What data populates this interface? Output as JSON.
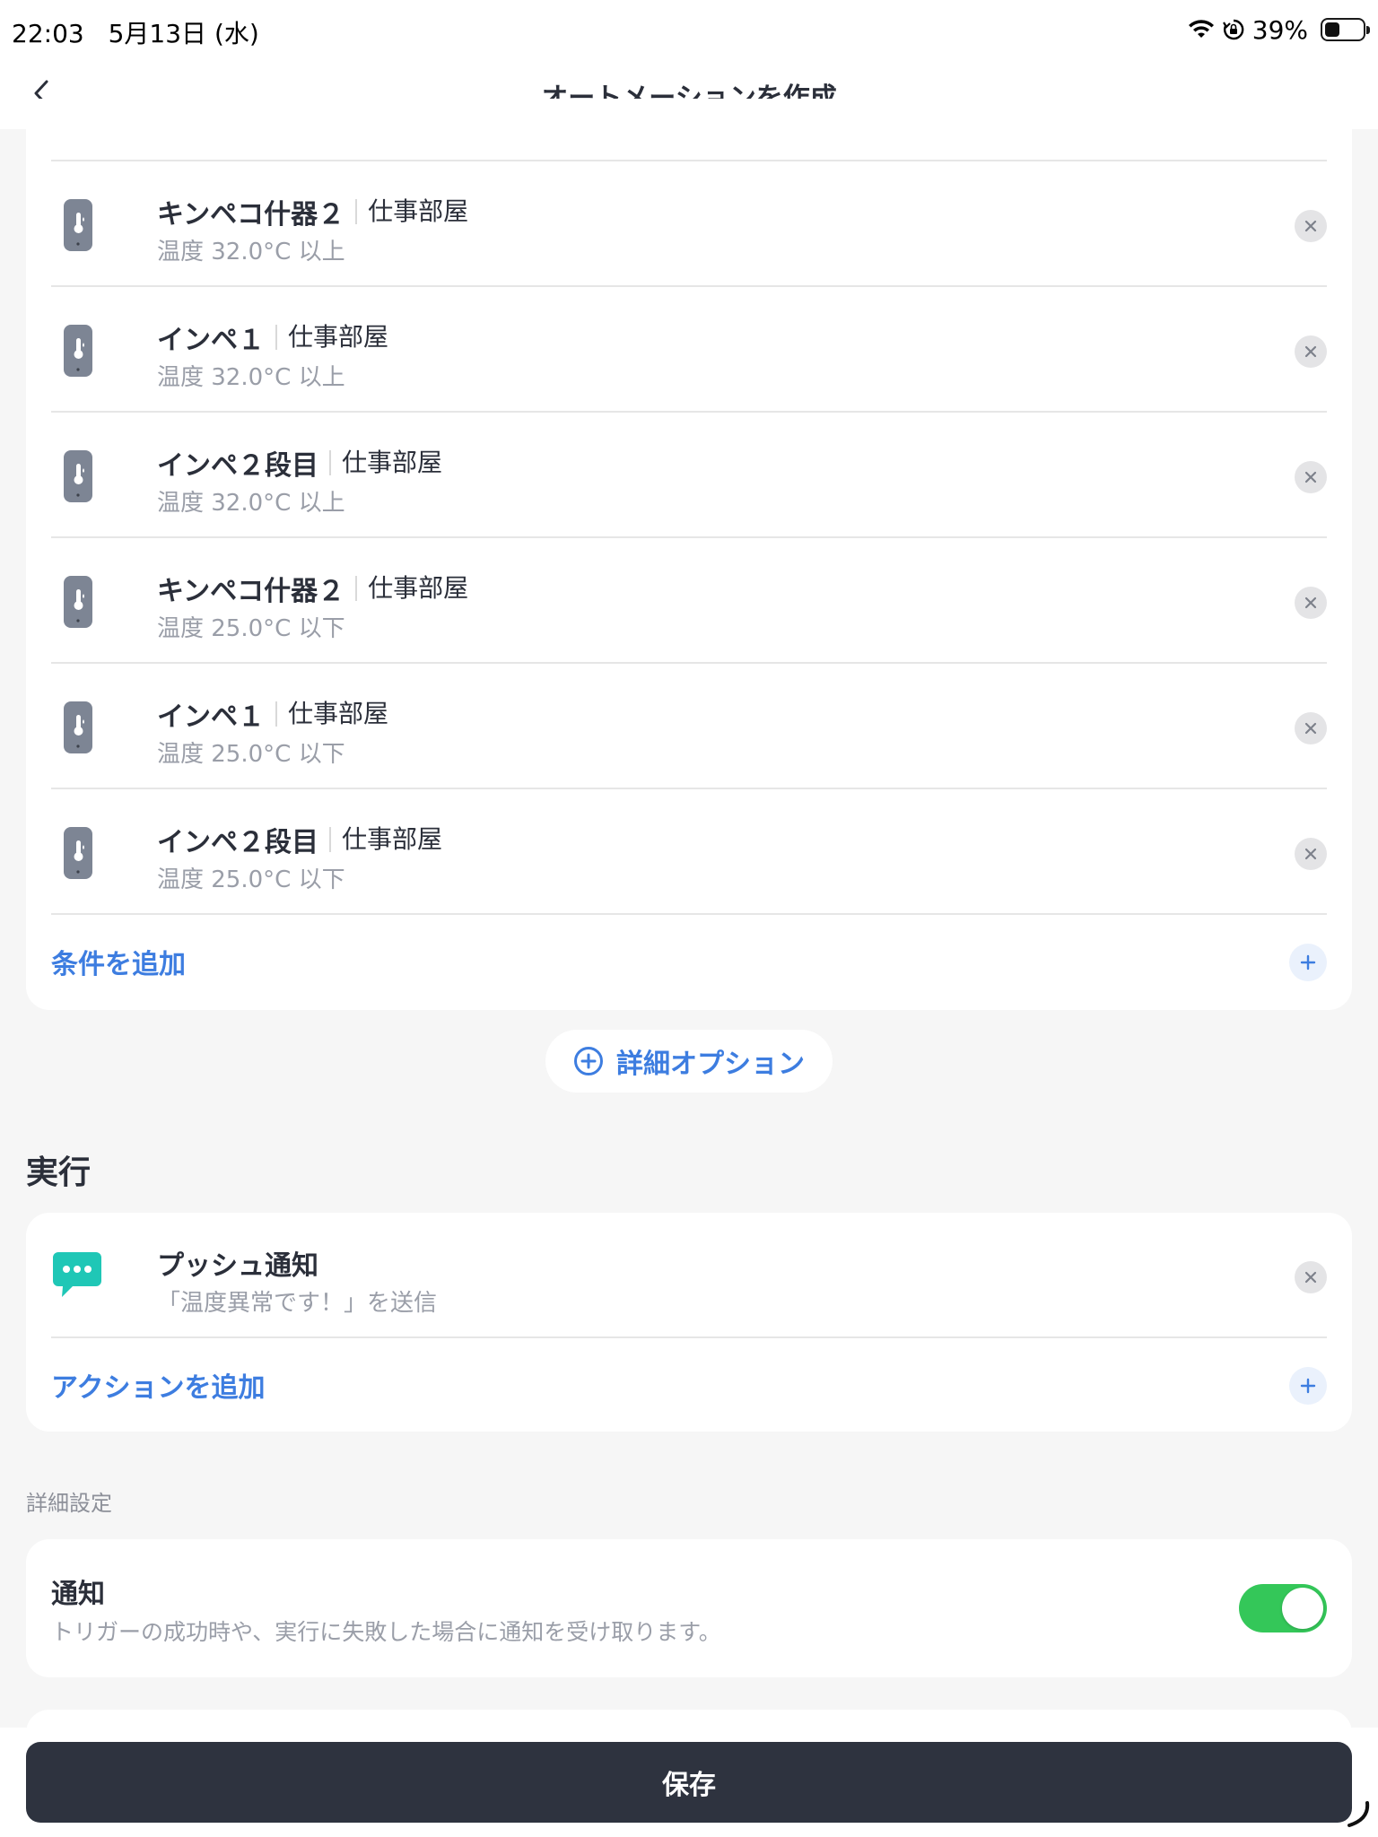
{
  "status_bar": {
    "time": "22:03",
    "date": "5月13日 (水)",
    "battery": "39%",
    "battery_level": 0.39
  },
  "nav": {
    "title": "オートメーションを作成",
    "back_icon": "chevron-left-icon"
  },
  "conditions": {
    "items": [
      {
        "name": "キンペコ什器２",
        "room": "仕事部屋",
        "condition": "温度 32.0°C 以上"
      },
      {
        "name": "インペ１",
        "room": "仕事部屋",
        "condition": "温度 32.0°C 以上"
      },
      {
        "name": "インペ２段目",
        "room": "仕事部屋",
        "condition": "温度 32.0°C 以上"
      },
      {
        "name": "キンペコ什器２",
        "room": "仕事部屋",
        "condition": "温度 25.0°C 以下"
      },
      {
        "name": "インペ１",
        "room": "仕事部屋",
        "condition": "温度 25.0°C 以下"
      },
      {
        "name": "インペ２段目",
        "room": "仕事部屋",
        "condition": "温度 25.0°C 以下"
      }
    ],
    "add_label": "条件を追加"
  },
  "detail_option": {
    "label": "詳細オプション"
  },
  "execution": {
    "heading": "実行",
    "actions": [
      {
        "title": "プッシュ通知",
        "description": "「温度異常です！」を送信",
        "icon": "chat-bubble-icon"
      }
    ],
    "add_label": "アクションを追加"
  },
  "advanced": {
    "section_label": "詳細設定",
    "notify_title": "通知",
    "notify_desc": "トリガーの成功時や、実行に失敗した場合に通知を受け取ります。",
    "notify_enabled": true
  },
  "footer": {
    "save_label": "保存"
  },
  "colors": {
    "accent": "#3d7de0",
    "toggle_on": "#34c759",
    "save_button": "#2e333f",
    "chat_icon": "#1fc7b6"
  }
}
